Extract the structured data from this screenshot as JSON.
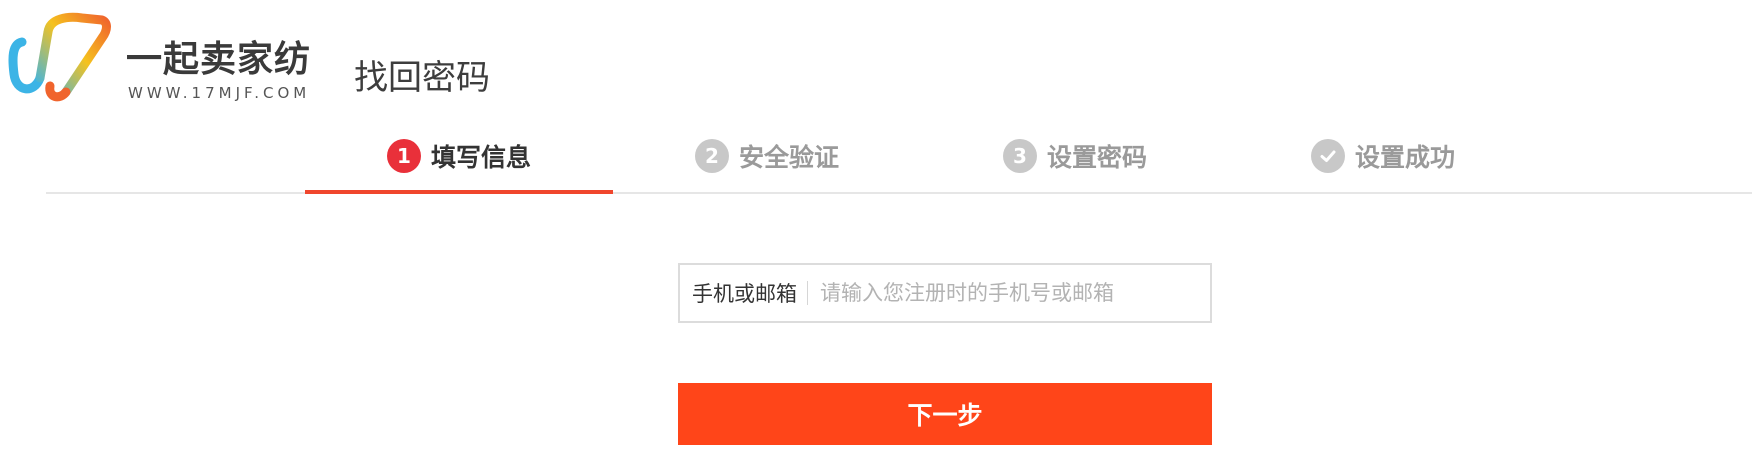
{
  "brand": {
    "name": "一起卖家纺",
    "url": "WWW.17MJF.COM",
    "colors": {
      "blue": "#3cb4e6",
      "orange": "#f0642d",
      "yellow": "#f5c21e"
    }
  },
  "header": {
    "title": "找回密码"
  },
  "steps": [
    {
      "number": "1",
      "label": "填写信息",
      "state": "active"
    },
    {
      "number": "2",
      "label": "安全验证",
      "state": "pending"
    },
    {
      "number": "3",
      "label": "设置密码",
      "state": "pending"
    },
    {
      "icon": "check-icon",
      "label": "设置成功",
      "state": "pending"
    }
  ],
  "form": {
    "account_label": "手机或邮箱",
    "account_placeholder": "请输入您注册时的手机号或邮箱",
    "account_value": "",
    "submit_label": "下一步"
  },
  "colors": {
    "accent": "#f0462d",
    "button": "#ff4519",
    "active_step_circle": "#e9303a",
    "inactive_step": "#c8c8c8"
  }
}
